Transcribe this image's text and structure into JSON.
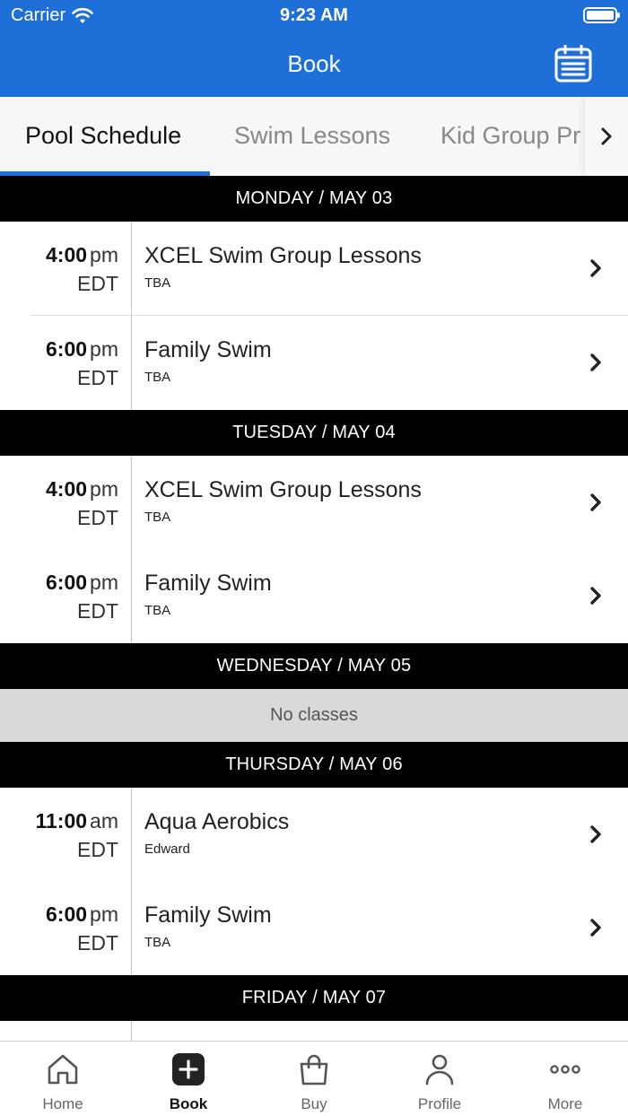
{
  "status_bar": {
    "carrier": "Carrier",
    "time": "9:23 AM"
  },
  "nav": {
    "title": "Book",
    "calendar_icon": "calendar-icon"
  },
  "tabs": [
    {
      "label": "Pool Schedule",
      "active": true
    },
    {
      "label": "Swim Lessons",
      "active": false
    },
    {
      "label": "Kid Group Pr",
      "active": false
    }
  ],
  "schedule": {
    "days": [
      {
        "header": "MONDAY / MAY 03",
        "classes": [
          {
            "time": "4:00",
            "ampm": "pm",
            "tz": "EDT",
            "name": "XCEL Swim Group Lessons",
            "sub": "TBA"
          },
          {
            "time": "6:00",
            "ampm": "pm",
            "tz": "EDT",
            "name": "Family Swim",
            "sub": "TBA"
          }
        ]
      },
      {
        "header": "TUESDAY / MAY 04",
        "classes": [
          {
            "time": "4:00",
            "ampm": "pm",
            "tz": "EDT",
            "name": "XCEL Swim Group Lessons",
            "sub": "TBA"
          },
          {
            "time": "6:00",
            "ampm": "pm",
            "tz": "EDT",
            "name": "Family Swim",
            "sub": "TBA"
          }
        ]
      },
      {
        "header": "WEDNESDAY / MAY 05",
        "empty_text": "No classes"
      },
      {
        "header": "THURSDAY / MAY 06",
        "classes": [
          {
            "time": "11:00",
            "ampm": "am",
            "tz": "EDT",
            "name": "Aqua Aerobics",
            "sub": "Edward"
          },
          {
            "time": "6:00",
            "ampm": "pm",
            "tz": "EDT",
            "name": "Family Swim",
            "sub": "TBA"
          }
        ]
      },
      {
        "header": "FRIDAY / MAY 07"
      }
    ]
  },
  "tab_bar": {
    "items": [
      {
        "label": "Home",
        "icon": "home-icon"
      },
      {
        "label": "Book",
        "icon": "plus-square-icon",
        "active": true
      },
      {
        "label": "Buy",
        "icon": "shopping-bag-icon"
      },
      {
        "label": "Profile",
        "icon": "person-icon"
      },
      {
        "label": "More",
        "icon": "more-dots-icon"
      }
    ]
  },
  "colors": {
    "brand": "#1f6fd8",
    "header_bg": "#000000",
    "empty_bg": "#d9d9d9"
  }
}
